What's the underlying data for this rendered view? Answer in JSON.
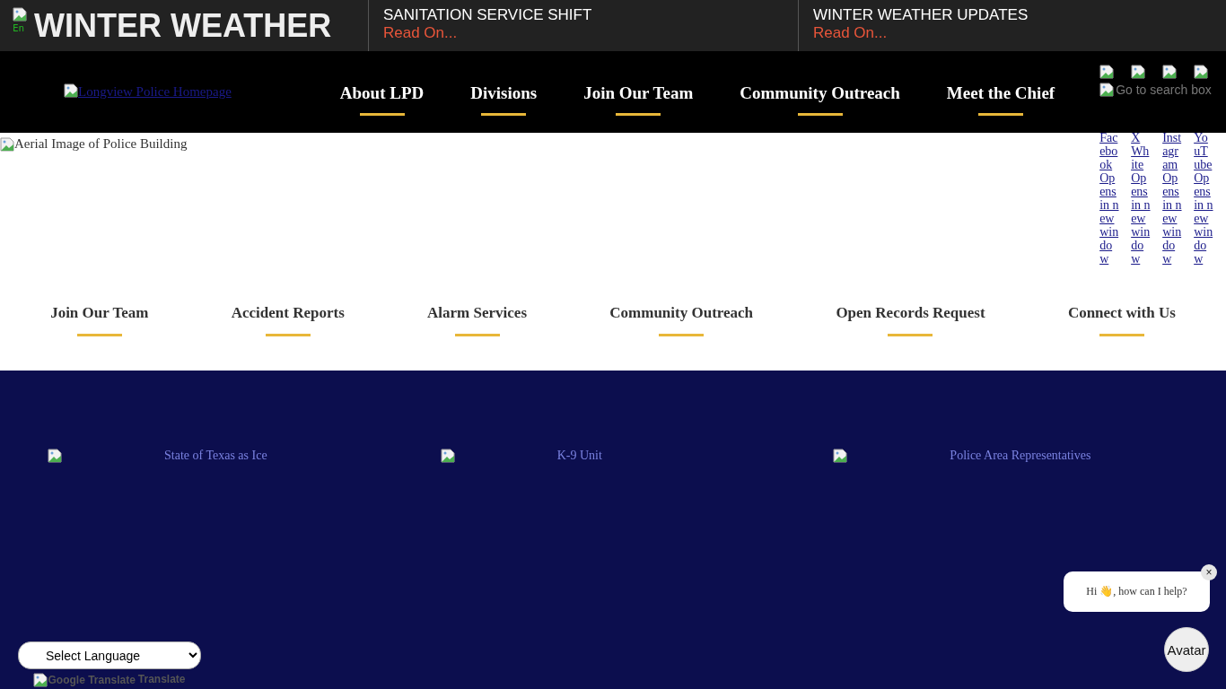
{
  "alert_bar": {
    "brand_alt": "En",
    "brand_title": "WINTER WEATHER",
    "items": [
      {
        "title": "SANITATION SERVICE SHIFT",
        "link": "Read On..."
      },
      {
        "title": "WINTER WEATHER UPDATES",
        "link": "Read On..."
      }
    ]
  },
  "nav": {
    "logo_alt": "Longview Police Homepage",
    "items": [
      "About LPD",
      "Divisions",
      "Join Our Team",
      "Community Outreach",
      "Meet the Chief"
    ],
    "social": [
      {
        "name": "Facebook",
        "note": "Opens in new window"
      },
      {
        "name": "X White",
        "note": "Opens in new window"
      },
      {
        "name": "Instagram",
        "note": "Opens in new window"
      },
      {
        "name": "YouTube",
        "note": "Opens in new window"
      }
    ],
    "search_alt": "Go to search box"
  },
  "hero": {
    "image_alt": "Aerial Image of Police Building"
  },
  "quick_links": [
    "Join Our Team",
    "Accident Reports",
    "Alarm Services",
    "Community Outreach",
    "Open Records Request",
    "Connect with Us"
  ],
  "features": [
    "State of Texas as Ice",
    "K-9 Unit",
    "Police Area Representatives"
  ],
  "chat": {
    "message": "Hi 👋, how can I help?",
    "close": "×",
    "avatar": "Avatar"
  },
  "translate": {
    "select": "Select Language",
    "credit_alt": "Google Translate",
    "credit": "Translate"
  }
}
